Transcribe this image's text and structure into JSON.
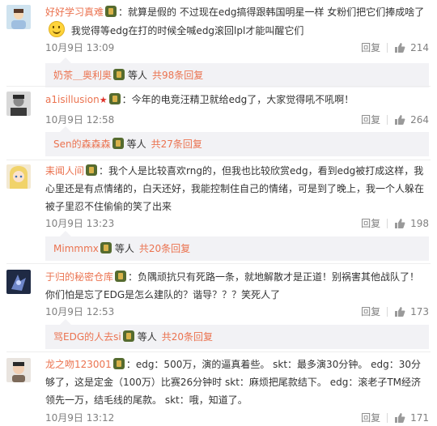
{
  "comments": [
    {
      "user": "好好学习真难",
      "text_1": "：就算是假的 不过现在edg搞得跟韩国明星一样 女粉们把它们捧成啥了",
      "text_2": " 我觉得等edg在打的时候全喊edg滚回lpl才能叫醒它们",
      "time": "10月9日 13:09",
      "reply": "回复",
      "likes": "214",
      "sub": {
        "name": "奶茶＿奥利奥",
        "text": "等人",
        "count": "共98条回复"
      }
    },
    {
      "user": "a1isillusion",
      "text_1": "：今年的电竞汪精卫就给edg了，大家觉得吼不吼啊！",
      "time": "10月9日 12:58",
      "reply": "回复",
      "likes": "264",
      "sub": {
        "name": "Sen的森森森",
        "text": "等人",
        "count": "共27条回复"
      }
    },
    {
      "user": "耒闻人间",
      "text_1": "：我个人是比较喜欢rng的，但我也比较欣赏edg，看到edg被打成这样，我心里还是有点情绪的，白天还好，我能控制住自己的情绪，可是到了晚上，我一个人躲在被子里忍不住偷偷的笑了出来",
      "time": "10月9日 13:23",
      "reply": "回复",
      "likes": "198",
      "sub": {
        "name": "Mimmmx",
        "text": "等人",
        "count": "共20条回复"
      }
    },
    {
      "user": "于归的秘密仓库",
      "text_1": "：负隅顽抗只有死路一条，就地解散才是正道！别祸害其他战队了！你们怕是忘了EDG是怎么建队的？谐导？？？笑死人了",
      "time": "10月9日 12:53",
      "reply": "回复",
      "likes": "173",
      "sub": {
        "name": "骂EDG的人去si",
        "text": "等人",
        "count": "共20条回复"
      }
    },
    {
      "user": "龙之吻123001",
      "text_1": "：edg：500万，演的逼真着些。 skt：最多演30分钟。 edg：30分够了，这是定金（100万）比赛26分钟时 skt：麻烦把尾款结下。 edg：滚老子TM经济领先一万，结毛线的尾款。 skt：哦，知道了。",
      "time": "10月9日 13:12",
      "reply": "回复",
      "likes": "171"
    }
  ],
  "colors": {
    "name": "#eb7350",
    "meta": "#808080",
    "subbox": "#f2f2f5"
  },
  "icons": {
    "thumb": "thumbs-up-icon",
    "badge": "member-badge-icon",
    "star": "star-icon",
    "emoji": "smile-emoji-icon"
  }
}
